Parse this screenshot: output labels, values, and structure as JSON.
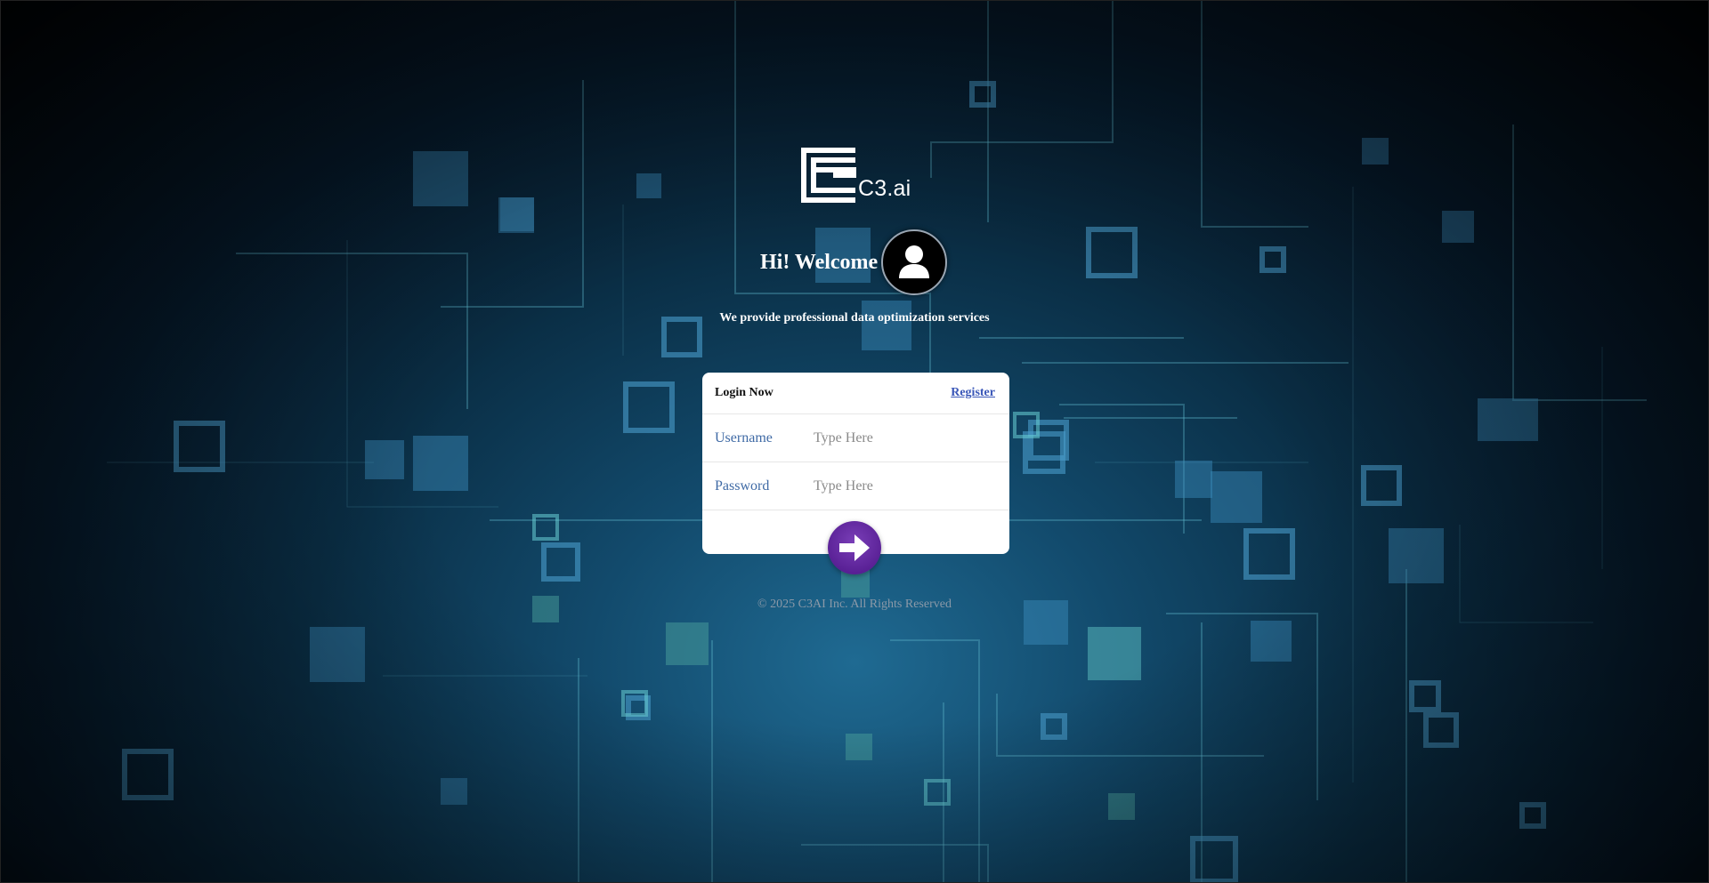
{
  "brand": {
    "logo_text": "C3.ai"
  },
  "welcome": {
    "title": "Hi! Welcome",
    "tagline": "We provide professional data optimization services"
  },
  "login_card": {
    "title": "Login Now",
    "register_label": "Register",
    "fields": [
      {
        "label": "Username",
        "placeholder": "Type Here"
      },
      {
        "label": "Password",
        "placeholder": "Type Here"
      }
    ]
  },
  "footer": {
    "copyright": "© 2025 C3AI Inc. All Rights Reserved"
  },
  "icons": {
    "avatar": "user-icon",
    "submit": "arrow-right-icon"
  },
  "colors": {
    "accent": "#5a2196",
    "label": "#3f6aa5",
    "link": "#3a57b8"
  }
}
